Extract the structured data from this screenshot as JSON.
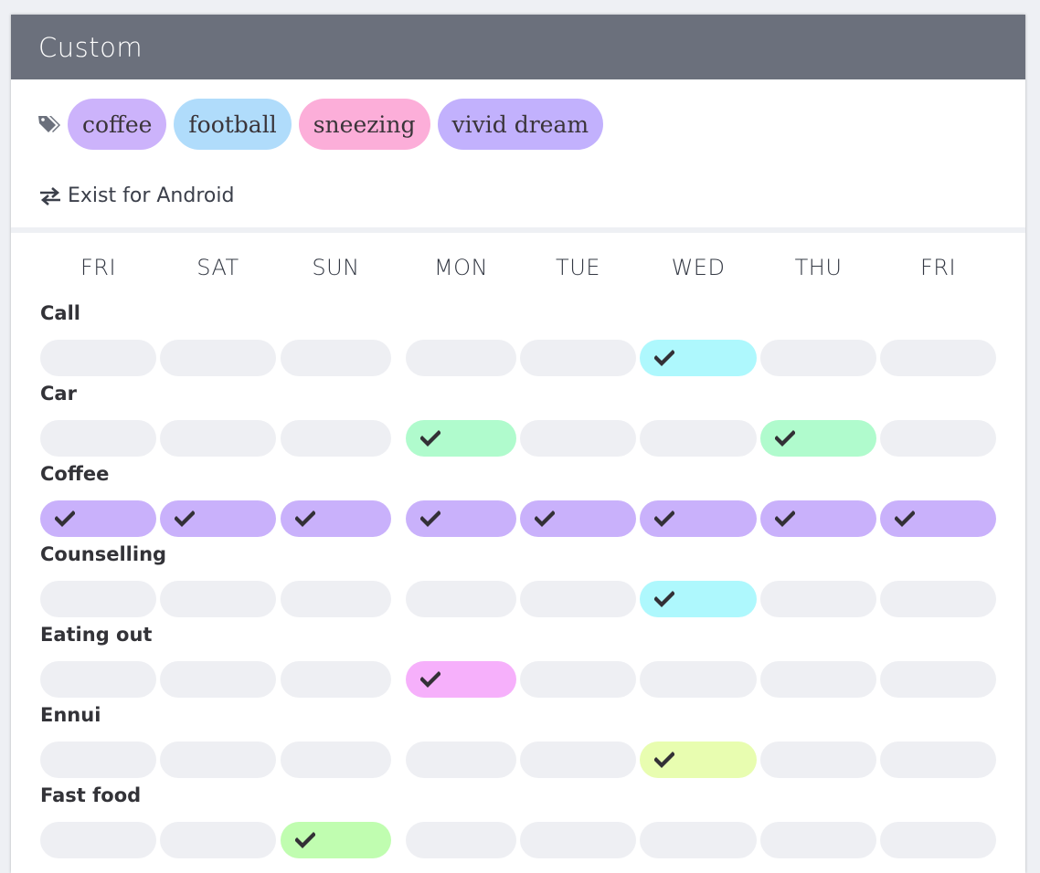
{
  "header": {
    "title": "Custom"
  },
  "tags": {
    "icon": "tags-icon",
    "items": [
      {
        "label": "coffee",
        "color": "#ccb3fb"
      },
      {
        "label": "football",
        "color": "#b0dcfb"
      },
      {
        "label": "sneezing",
        "color": "#fcaed9"
      },
      {
        "label": "vivid dream",
        "color": "#c2b1fd"
      }
    ]
  },
  "sync": {
    "icon": "exchange-arrows-icon",
    "label": "Exist for Android"
  },
  "days": [
    "FRI",
    "SAT",
    "SUN",
    "MON",
    "TUE",
    "WED",
    "THU",
    "FRI"
  ],
  "empty_color": "#eeeff3",
  "rows": [
    {
      "label": "Call",
      "color": "#aef8fd",
      "checked": [
        false,
        false,
        false,
        false,
        false,
        true,
        false,
        false
      ]
    },
    {
      "label": "Car",
      "color": "#b0fbcd",
      "checked": [
        false,
        false,
        false,
        true,
        false,
        false,
        true,
        false
      ]
    },
    {
      "label": "Coffee",
      "color": "#c9b1fb",
      "checked": [
        true,
        true,
        true,
        true,
        true,
        true,
        true,
        true
      ]
    },
    {
      "label": "Counselling",
      "color": "#aef8fd",
      "checked": [
        false,
        false,
        false,
        false,
        false,
        true,
        false,
        false
      ]
    },
    {
      "label": "Eating out",
      "color": "#f6b0fb",
      "checked": [
        false,
        false,
        false,
        true,
        false,
        false,
        false,
        false
      ]
    },
    {
      "label": "Ennui",
      "color": "#e8fdb0",
      "checked": [
        false,
        false,
        false,
        false,
        false,
        true,
        false,
        false
      ]
    },
    {
      "label": "Fast food",
      "color": "#c0fdb0",
      "checked": [
        false,
        false,
        true,
        false,
        false,
        false,
        false,
        false
      ]
    }
  ]
}
